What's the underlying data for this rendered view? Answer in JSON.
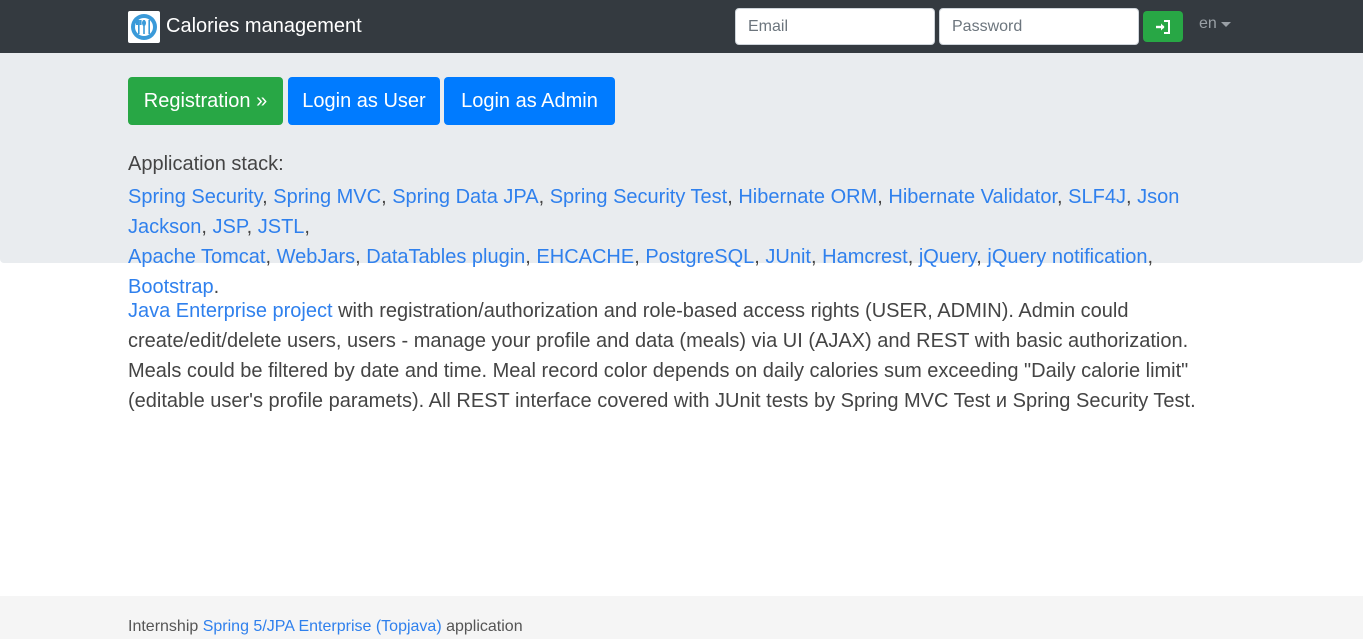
{
  "navbar": {
    "brand_text": "Calories management",
    "email_placeholder": "Email",
    "password_placeholder": "Password",
    "login_icon": "sign-in-icon",
    "lang_label": "en"
  },
  "jumbotron": {
    "registration_label": "Registration »",
    "login_user_label": "Login as User",
    "login_admin_label": "Login as Admin",
    "stack_label": "Application stack:",
    "stack_items": [
      "Spring Security",
      "Spring MVC",
      "Spring Data JPA",
      "Spring Security Test",
      "Hibernate ORM",
      "Hibernate Validator",
      "SLF4J",
      "Json Jackson",
      "JSP",
      "JSTL",
      "Apache Tomcat",
      "WebJars",
      "DataTables plugin",
      "EHCACHE",
      "PostgreSQL",
      "JUnit",
      "Hamcrest",
      "jQuery",
      "jQuery notification",
      "Bootstrap"
    ],
    "stack_end": "."
  },
  "description": {
    "link_text": "Java Enterprise project",
    "text": " with registration/authorization and role-based access rights (USER, ADMIN). Admin could create/edit/delete users, users - manage your profile and data (meals) via UI (AJAX) and REST with basic authorization. Meals could be filtered by date and time. Meal record color depends on daily calories sum exceeding \"Daily calorie limit\" (editable user's profile paramets). All REST interface covered with JUnit tests by Spring MVC Test и Spring Security Test."
  },
  "footer": {
    "prefix": "Internship ",
    "link_text": "Spring 5/JPA Enterprise (Topjava)",
    "suffix": " application"
  },
  "colors": {
    "navbar_bg": "#343a40",
    "jumbotron_bg": "#e9ecef",
    "success": "#28a745",
    "primary": "#007bff",
    "link": "#2f80ed"
  }
}
